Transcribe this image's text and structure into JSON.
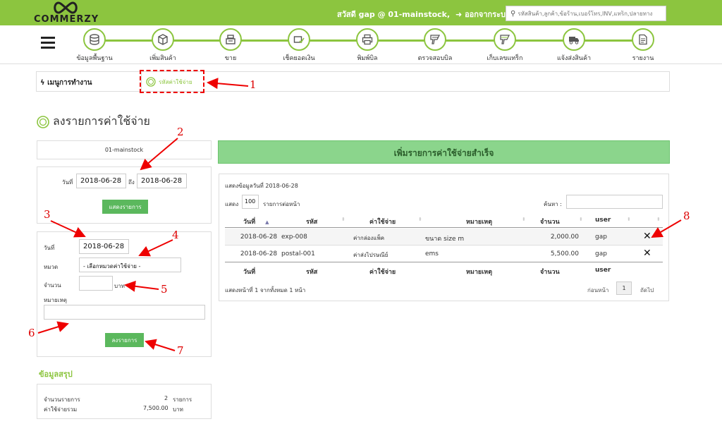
{
  "header": {
    "brand": "COMMERZY",
    "greeting": "สวัสดี gap @ 01-mainstock,",
    "logout": "ออกจากระบบ",
    "search_placeholder": "รหัสสินค้า,ลูกค้า,ข้อร้าน,เบอร์โทร,INV,แทร็ก,ปลายทาง"
  },
  "nav": [
    {
      "label": "ข้อมูลพื้นฐาน",
      "icon": "database-icon"
    },
    {
      "label": "เพิ่มสินค้า",
      "icon": "box-icon"
    },
    {
      "label": "ขาย",
      "icon": "cash-register-icon"
    },
    {
      "label": "เช็คยอดเงิน",
      "icon": "money-check-icon"
    },
    {
      "label": "พิมพ์บิล",
      "icon": "printer-icon"
    },
    {
      "label": "ตรวจสอบบิล",
      "icon": "barcode-scanner-icon"
    },
    {
      "label": "เก็บเลขแทร็ก",
      "icon": "tracking-scanner-icon"
    },
    {
      "label": "แจ้งส่งสินค้า",
      "icon": "truck-icon"
    },
    {
      "label": "รายงาน",
      "icon": "report-icon"
    }
  ],
  "breadcrumb": {
    "menu_title": "เมนูการทำงาน",
    "current": "รหัสค่าใช้จ่าย"
  },
  "page_title": "ลงรายการค่าใช้จ่าย",
  "stock_name": "01-mainstock",
  "filter": {
    "from_label": "วันที่",
    "from_value": "2018-06-28",
    "to_label": "ถึง",
    "to_value": "2018-06-28",
    "button": "แสดงรายการ"
  },
  "form": {
    "date_label": "วันที่",
    "date_value": "2018-06-28",
    "category_label": "หมวด",
    "category_value": "- เลือกหมวดค่าใช้จ่าย -",
    "amount_label": "จำนวน",
    "amount_unit": "บาท",
    "note_label": "หมายเหตุ",
    "submit": "ลงรายการ"
  },
  "success_message": "เพิ่มรายการค่าใช้จ่ายสำเร็จ",
  "table": {
    "showing_date": "แสดงข้อมูลวันที่ 2018-06-28",
    "show_label": "แสดง",
    "page_size": "100",
    "per_page_label": "รายการต่อหน้า",
    "search_label": "ค้นหา :",
    "columns": [
      "วันที่",
      "รหัส",
      "ค่าใช้จ่าย",
      "หมายเหตุ",
      "จำนวน",
      "user"
    ],
    "rows": [
      {
        "date": "2018-06-28",
        "code": "exp-008",
        "expense": "ค่ากล่องแพ็ค",
        "note": "ขนาด size m",
        "amount": "2,000.00",
        "user": "gap"
      },
      {
        "date": "2018-06-28",
        "code": "postal-001",
        "expense": "ค่าส่งไปรษณีย์",
        "note": "ems",
        "amount": "5,500.00",
        "user": "gap"
      }
    ],
    "footer_info": "แสดงหน้าที่ 1 จากทั้งหมด 1 หน้า",
    "prev": "ก่อนหน้า",
    "page": "1",
    "next": "ถัดไป"
  },
  "summary": {
    "title": "ข้อมูลสรุป",
    "count_label": "จำนวนรายการ",
    "count_value": "2",
    "count_unit": "รายการ",
    "total_label": "ค่าใช้จ่ายรวม",
    "total_value": "7,500.00",
    "total_unit": "บาท"
  },
  "annotations": [
    "1",
    "2",
    "3",
    "4",
    "5",
    "6",
    "7",
    "8"
  ],
  "colors": {
    "brand_green": "#8cc53f",
    "button_green": "#5bb85d",
    "success_bg": "#8bd58c",
    "annotation_red": "#e00000"
  }
}
